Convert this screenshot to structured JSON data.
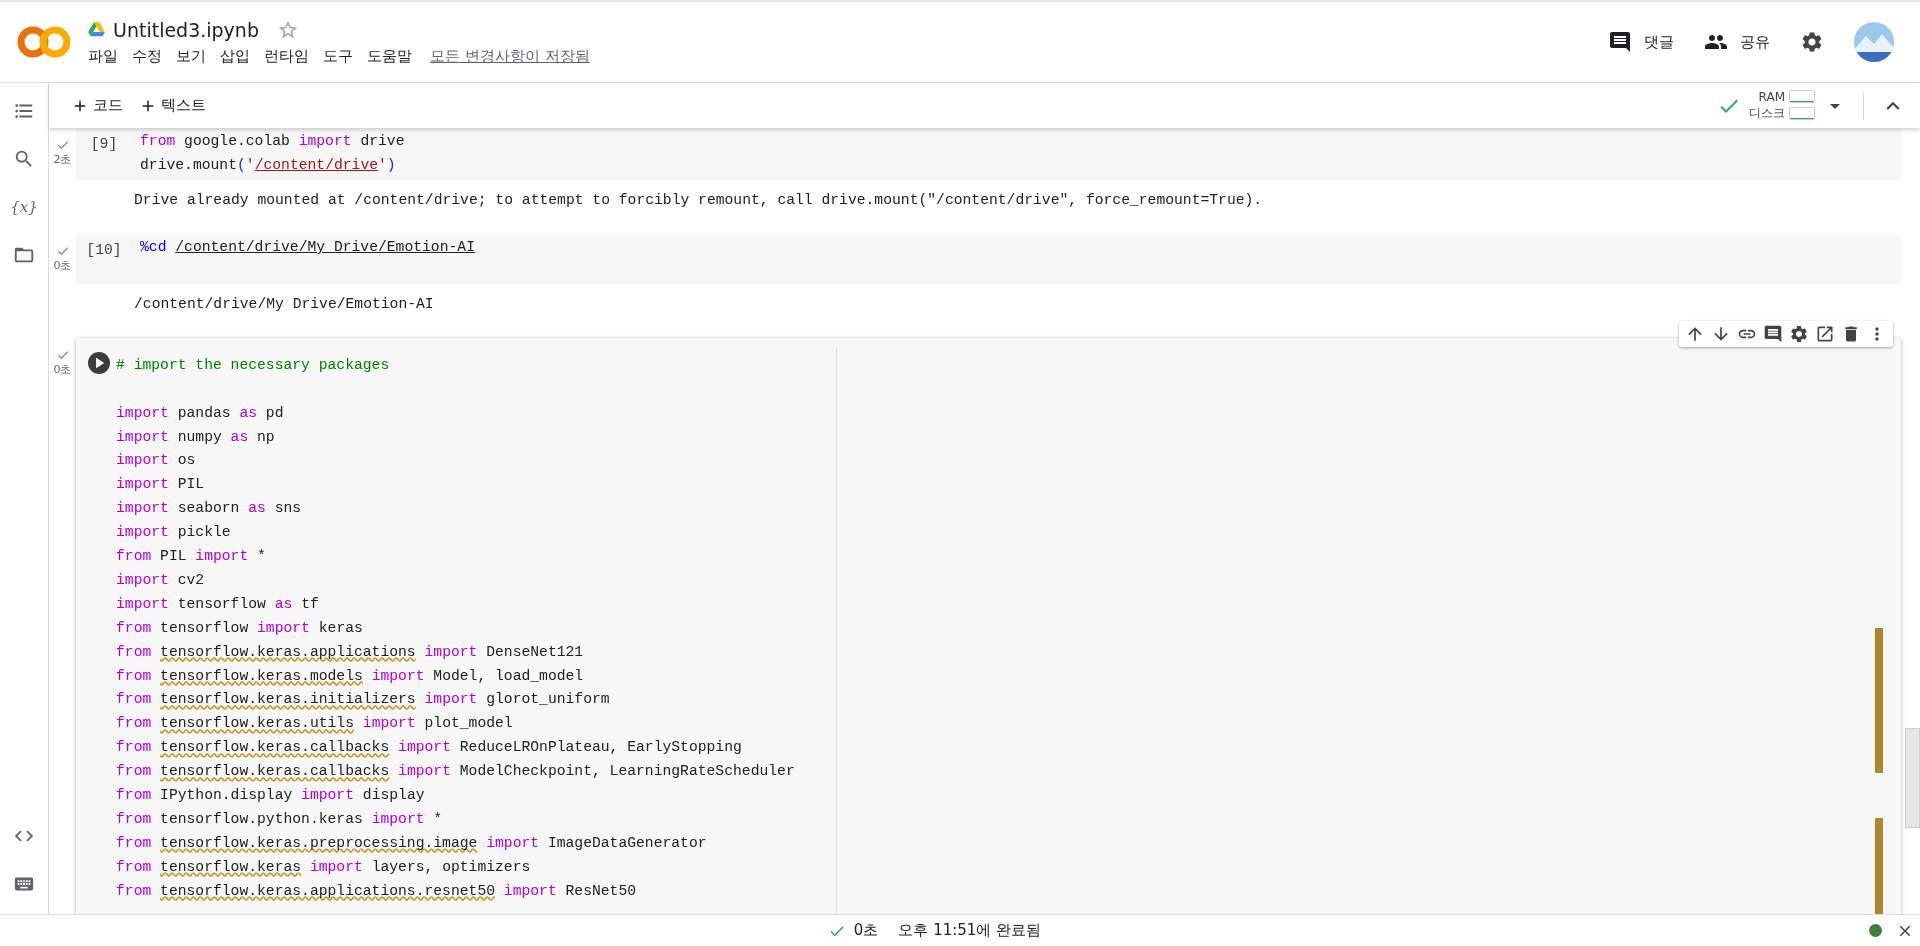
{
  "document": {
    "title": "Untitled3.ipynb",
    "save_status": "모든 변경사항이 저장됨"
  },
  "menu": [
    "파일",
    "수정",
    "보기",
    "삽입",
    "런타임",
    "도구",
    "도움말"
  ],
  "header_actions": [
    {
      "kind": "comment",
      "label": "댓글"
    },
    {
      "kind": "share",
      "label": "공유"
    }
  ],
  "sidebar": {
    "variables_label": "{x}"
  },
  "toolbar": {
    "add_buttons": [
      "코드",
      "텍스트"
    ],
    "ram_label": "RAM",
    "disk_label": "디스크"
  },
  "cells": [
    {
      "selected": false,
      "exec_count": "[9]",
      "duration": "2초",
      "lines": [
        {
          "kind": "code",
          "tokens": [
            {
              "kind": "kw",
              "text": "from"
            },
            {
              "kind": "text",
              "text": " google.colab "
            },
            {
              "kind": "kw",
              "text": "import"
            },
            {
              "kind": "text",
              "text": " drive"
            }
          ]
        },
        {
          "kind": "code",
          "tokens": [
            {
              "kind": "text",
              "text": "drive.mount"
            },
            {
              "kind": "punct",
              "text": "("
            },
            {
              "kind": "str",
              "text": "'"
            },
            {
              "kind": "strlink",
              "text": "/content/drive"
            },
            {
              "kind": "str",
              "text": "'"
            },
            {
              "kind": "punct",
              "text": ")"
            }
          ]
        }
      ],
      "output": "Drive already mounted at /content/drive; to attempt to forcibly remount, call drive.mount(\"/content/drive\", force_remount=True)."
    },
    {
      "selected": false,
      "exec_count": "[10]",
      "duration": "0초",
      "lines": [
        {
          "kind": "code",
          "tokens": [
            {
              "kind": "magic",
              "text": "%cd "
            },
            {
              "kind": "link",
              "text": "/content/drive/My Drive/Emotion-AI"
            }
          ]
        }
      ],
      "output": "/content/drive/My Drive/Emotion-AI"
    },
    {
      "selected": true,
      "duration": "0초",
      "lines": [
        {
          "kind": "code",
          "tokens": [
            {
              "kind": "comment",
              "text": "# import the necessary packages"
            }
          ]
        },
        {
          "kind": "blank"
        },
        {
          "kind": "code",
          "tokens": [
            {
              "kind": "kw",
              "text": "import"
            },
            {
              "kind": "text",
              "text": " pandas "
            },
            {
              "kind": "kw",
              "text": "as"
            },
            {
              "kind": "text",
              "text": " pd"
            }
          ]
        },
        {
          "kind": "code",
          "tokens": [
            {
              "kind": "kw",
              "text": "import"
            },
            {
              "kind": "text",
              "text": " numpy "
            },
            {
              "kind": "kw",
              "text": "as"
            },
            {
              "kind": "text",
              "text": " np"
            }
          ]
        },
        {
          "kind": "code",
          "tokens": [
            {
              "kind": "kw",
              "text": "import"
            },
            {
              "kind": "text",
              "text": " os"
            }
          ]
        },
        {
          "kind": "code",
          "tokens": [
            {
              "kind": "kw",
              "text": "import"
            },
            {
              "kind": "text",
              "text": " PIL"
            }
          ]
        },
        {
          "kind": "code",
          "tokens": [
            {
              "kind": "kw",
              "text": "import"
            },
            {
              "kind": "text",
              "text": " seaborn "
            },
            {
              "kind": "kw",
              "text": "as"
            },
            {
              "kind": "text",
              "text": " sns"
            }
          ]
        },
        {
          "kind": "code",
          "tokens": [
            {
              "kind": "kw",
              "text": "import"
            },
            {
              "kind": "text",
              "text": " pickle"
            }
          ]
        },
        {
          "kind": "code",
          "tokens": [
            {
              "kind": "kw",
              "text": "from"
            },
            {
              "kind": "text",
              "text": " PIL "
            },
            {
              "kind": "kw",
              "text": "import"
            },
            {
              "kind": "text",
              "text": " *"
            }
          ]
        },
        {
          "kind": "code",
          "tokens": [
            {
              "kind": "kw",
              "text": "import"
            },
            {
              "kind": "text",
              "text": " cv2"
            }
          ]
        },
        {
          "kind": "code",
          "tokens": [
            {
              "kind": "kw",
              "text": "import"
            },
            {
              "kind": "text",
              "text": " tensorflow "
            },
            {
              "kind": "kw",
              "text": "as"
            },
            {
              "kind": "text",
              "text": " tf"
            }
          ]
        },
        {
          "kind": "code",
          "tokens": [
            {
              "kind": "kw",
              "text": "from"
            },
            {
              "kind": "text",
              "text": " tensorflow "
            },
            {
              "kind": "kw",
              "text": "import"
            },
            {
              "kind": "text",
              "text": " keras"
            }
          ]
        },
        {
          "kind": "code",
          "tokens": [
            {
              "kind": "kw",
              "text": "from "
            },
            {
              "kind": "mod",
              "text": "tensorflow.keras.applications"
            },
            {
              "kind": "kw",
              "text": " import"
            },
            {
              "kind": "text",
              "text": " DenseNet121"
            }
          ]
        },
        {
          "kind": "code",
          "tokens": [
            {
              "kind": "kw",
              "text": "from "
            },
            {
              "kind": "mod",
              "text": "tensorflow.keras.models"
            },
            {
              "kind": "kw",
              "text": " import"
            },
            {
              "kind": "text",
              "text": " Model, load_model"
            }
          ]
        },
        {
          "kind": "code",
          "tokens": [
            {
              "kind": "kw",
              "text": "from "
            },
            {
              "kind": "mod",
              "text": "tensorflow.keras.initializers"
            },
            {
              "kind": "kw",
              "text": " import"
            },
            {
              "kind": "text",
              "text": " glorot_uniform"
            }
          ]
        },
        {
          "kind": "code",
          "tokens": [
            {
              "kind": "kw",
              "text": "from "
            },
            {
              "kind": "mod",
              "text": "tensorflow.keras.utils"
            },
            {
              "kind": "kw",
              "text": " import"
            },
            {
              "kind": "text",
              "text": " plot_model"
            }
          ]
        },
        {
          "kind": "code",
          "tokens": [
            {
              "kind": "kw",
              "text": "from "
            },
            {
              "kind": "mod",
              "text": "tensorflow.keras.callbacks"
            },
            {
              "kind": "kw",
              "text": " import"
            },
            {
              "kind": "text",
              "text": " ReduceLROnPlateau, EarlyStopping"
            }
          ]
        },
        {
          "kind": "code",
          "tokens": [
            {
              "kind": "kw",
              "text": "from "
            },
            {
              "kind": "mod",
              "text": "tensorflow.keras.callbacks"
            },
            {
              "kind": "kw",
              "text": " import"
            },
            {
              "kind": "text",
              "text": " ModelCheckpoint, LearningRateScheduler"
            }
          ]
        },
        {
          "kind": "code",
          "tokens": [
            {
              "kind": "kw",
              "text": "from"
            },
            {
              "kind": "text",
              "text": " IPython.display "
            },
            {
              "kind": "kw",
              "text": "import"
            },
            {
              "kind": "text",
              "text": " display"
            }
          ]
        },
        {
          "kind": "code",
          "tokens": [
            {
              "kind": "kw",
              "text": "from"
            },
            {
              "kind": "text",
              "text": " tensorflow.python.keras "
            },
            {
              "kind": "kw",
              "text": "import"
            },
            {
              "kind": "text",
              "text": " *"
            }
          ]
        },
        {
          "kind": "code",
          "tokens": [
            {
              "kind": "kw",
              "text": "from "
            },
            {
              "kind": "mod",
              "text": "tensorflow.keras.preprocessing.image"
            },
            {
              "kind": "kw",
              "text": " import"
            },
            {
              "kind": "text",
              "text": " ImageDataGenerator"
            }
          ]
        },
        {
          "kind": "code",
          "tokens": [
            {
              "kind": "kw",
              "text": "from "
            },
            {
              "kind": "mod",
              "text": "tensorflow.keras"
            },
            {
              "kind": "kw",
              "text": " import"
            },
            {
              "kind": "text",
              "text": " layers, optimizers"
            }
          ]
        },
        {
          "kind": "code",
          "tokens": [
            {
              "kind": "kw",
              "text": "from "
            },
            {
              "kind": "mod",
              "text": "tensorflow.keras.applications.resnet50"
            },
            {
              "kind": "kw",
              "text": " import"
            },
            {
              "kind": "text",
              "text": " ResNet50"
            }
          ]
        }
      ]
    }
  ],
  "status_bar": {
    "duration": "0초",
    "message": "오후 11:51에 완료됨"
  }
}
